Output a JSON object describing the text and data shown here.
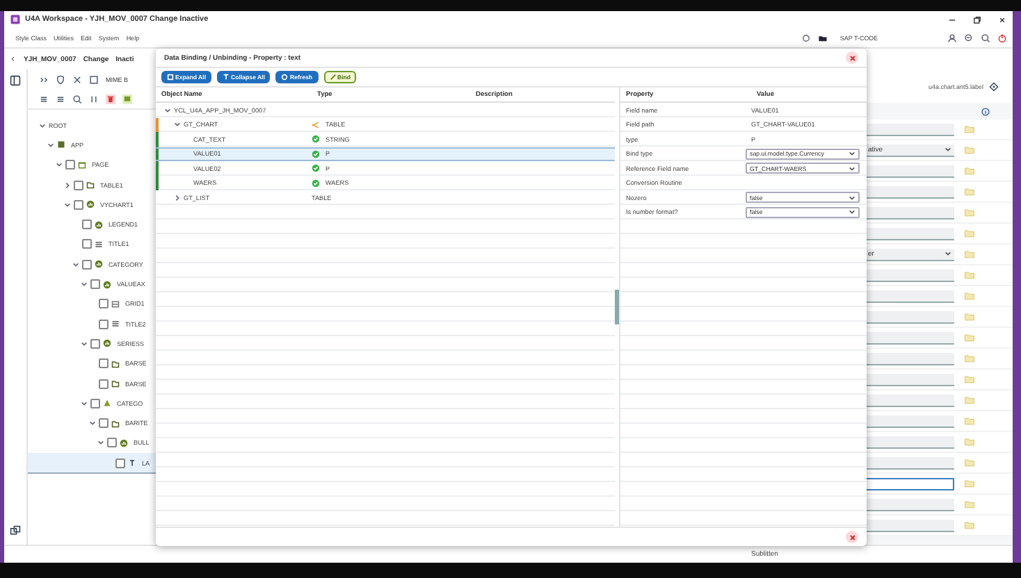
{
  "window": {
    "title": "U4A Workspace - YJH_MOV_0007 Change Inactive"
  },
  "menu": [
    "Style Class",
    "Utilities",
    "Edit",
    "System",
    "Help"
  ],
  "header": {
    "app_id": "YJH_MOV_0007",
    "mode": "Change",
    "status": "Inacti",
    "tcode_label": "SAP T-CODE"
  },
  "toolbar": {
    "mime_label": "MIME B"
  },
  "tree": [
    {
      "label": "ROOT",
      "expanded": true,
      "children": [
        {
          "label": "APP",
          "kind": "app",
          "expanded": true,
          "children": [
            {
              "label": "PAGE",
              "kind": "page",
              "checked": false,
              "expanded": true,
              "children": [
                {
                  "label": "TABLE1",
                  "kind": "folder",
                  "checked": false,
                  "expanded": false
                },
                {
                  "label": "VYCHART1",
                  "kind": "chart",
                  "checked": false,
                  "expanded": true,
                  "children": [
                    {
                      "label": "LEGEND1",
                      "kind": "chart",
                      "checked": false
                    },
                    {
                      "label": "TITLE1",
                      "kind": "title",
                      "checked": false
                    },
                    {
                      "label": "CATEGORY",
                      "kind": "chart",
                      "checked": false,
                      "expanded": true,
                      "children": [
                        {
                          "label": "VALUEAX",
                          "kind": "chart",
                          "checked": false,
                          "expanded": true,
                          "children": [
                            {
                              "label": "GRID1",
                              "kind": "grid",
                              "checked": false
                            },
                            {
                              "label": "TITLE2",
                              "kind": "title",
                              "checked": false
                            }
                          ]
                        },
                        {
                          "label": "SERIESS",
                          "kind": "chart",
                          "checked": false,
                          "expanded": true,
                          "children": [
                            {
                              "label": "BARSE",
                              "kind": "folder",
                              "checked": false
                            },
                            {
                              "label": "BARSE",
                              "kind": "folder",
                              "checked": false
                            }
                          ]
                        },
                        {
                          "label": "CATEGO",
                          "kind": "warn",
                          "checked": false,
                          "expanded": true,
                          "children": [
                            {
                              "label": "BARITE",
                              "kind": "folder",
                              "checked": false,
                              "expanded": true,
                              "children": [
                                {
                                  "label": "BULL",
                                  "kind": "chart",
                                  "checked": false,
                                  "expanded": true,
                                  "children": [
                                    {
                                      "label": "LA",
                                      "kind": "label",
                                      "checked": false,
                                      "selected": true
                                    }
                                  ]
                                }
                              ]
                            }
                          ]
                        }
                      ]
                    }
                  ]
                }
              ]
            }
          ]
        }
      ]
    }
  ],
  "right_panel": {
    "label": "u4a.chart.ant5.label",
    "fields": [
      {
        "kind": "input",
        "focused": false
      },
      {
        "kind": "select",
        "value": "ative",
        "focused": false
      },
      {
        "kind": "input",
        "focused": false
      },
      {
        "kind": "input",
        "focused": false
      },
      {
        "kind": "input",
        "focused": false
      },
      {
        "kind": "input",
        "focused": false
      },
      {
        "kind": "select",
        "value": "er",
        "focused": false
      },
      {
        "kind": "input",
        "focused": false
      },
      {
        "kind": "input",
        "focused": false
      },
      {
        "kind": "input",
        "focused": false
      },
      {
        "kind": "input",
        "focused": false
      },
      {
        "kind": "input",
        "focused": false
      },
      {
        "kind": "input",
        "focused": false
      },
      {
        "kind": "input",
        "focused": false
      },
      {
        "kind": "input",
        "focused": false
      },
      {
        "kind": "input",
        "focused": false
      },
      {
        "kind": "input",
        "focused": false
      },
      {
        "kind": "input",
        "focused": true
      },
      {
        "kind": "input",
        "focused": false
      },
      {
        "kind": "input",
        "focused": false
      }
    ]
  },
  "status_bar": {
    "text": "Sublitten"
  },
  "dialog": {
    "title": "Data Binding / Unbinding - Property : text",
    "buttons": [
      {
        "label": "Expand All",
        "kind": "expand"
      },
      {
        "label": "Collapse All",
        "kind": "collapse"
      },
      {
        "label": "Refresh",
        "kind": "refresh"
      },
      {
        "label": "Bind",
        "kind": "bind"
      }
    ],
    "object_table": {
      "columns": [
        "Object Name",
        "Type",
        "Description"
      ],
      "rows": [
        {
          "name": "YCL_U4A_APP_JH_MOV_0007",
          "selected": false,
          "expanded": true,
          "children": [
            {
              "name": "GT_CHART",
              "type": "TABLE",
              "kind": "table",
              "color": "#e8912c",
              "selected": false,
              "expanded": true,
              "children": [
                {
                  "name": "CAT_TEXT",
                  "type": "STRING",
                  "kind": "bound",
                  "color": "#2e8b3a",
                  "selected": false
                },
                {
                  "name": "VALUE01",
                  "type": "P",
                  "kind": "bound",
                  "color": "#2e8b3a",
                  "selected": true
                },
                {
                  "name": "VALUE02",
                  "type": "P",
                  "kind": "bound",
                  "color": "#2e8b3a",
                  "selected": false
                },
                {
                  "name": "WAERS",
                  "type": "WAERS",
                  "kind": "bound",
                  "color": "#2e8b3a",
                  "selected": false
                }
              ]
            },
            {
              "name": "GT_LIST",
              "type": "TABLE",
              "kind": "plain",
              "selected": false,
              "expanded": false
            }
          ]
        }
      ]
    },
    "property_table": {
      "columns": [
        "Property",
        "Value"
      ],
      "rows": [
        {
          "property": "Field name",
          "value": "VALUE01",
          "kind": "text"
        },
        {
          "property": "Field path",
          "value": "GT_CHART-VALUE01",
          "kind": "text"
        },
        {
          "property": "type",
          "value": "P",
          "kind": "text"
        },
        {
          "property": "Bind type",
          "value": "sap.ui.model.type.Currency",
          "kind": "select"
        },
        {
          "property": "Reference Field name",
          "value": "GT_CHART-WAERS",
          "kind": "select"
        },
        {
          "property": "Conversion Routine",
          "kind": "text"
        },
        {
          "property": "Nozero",
          "value": "false",
          "kind": "select"
        },
        {
          "property": "Is number format?",
          "value": "false",
          "kind": "select"
        }
      ]
    }
  }
}
